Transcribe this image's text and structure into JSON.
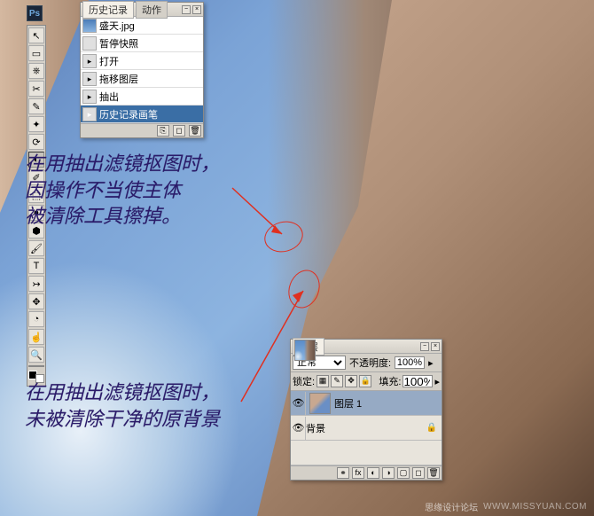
{
  "logo": "Ps",
  "tools": [
    "↖",
    "▭",
    "⎈",
    "✂",
    "✎",
    "✦",
    "⟳",
    "◐",
    "✐",
    "⬚",
    "●",
    "⬢",
    "🖌",
    "T",
    "↣",
    "✥",
    "◔",
    "☝",
    "🔍"
  ],
  "history_panel": {
    "tab_history": "历史记录",
    "tab_actions": "动作",
    "source_img": "盛天.jpg",
    "snapshot": "暂停快照",
    "items": [
      {
        "label": "打开"
      },
      {
        "label": "拖移图层"
      },
      {
        "label": "抽出"
      },
      {
        "label": "历史记录画笔"
      }
    ]
  },
  "layers_panel": {
    "tab_layers": "图层",
    "blend_mode": "正常",
    "opacity_label": "不透明度:",
    "opacity_val": "100%",
    "lock_label": "锁定:",
    "fill_label": "填充:",
    "fill_val": "100%",
    "layer1": "图层 1",
    "bg_layer": "背景"
  },
  "annotation1_l1": "在用抽出滤镜抠图时，",
  "annotation1_l2": "因操作不当使主体",
  "annotation1_l3": "被清除工具擦掉。",
  "annotation2_l1": "在用抽出滤镜抠图时，",
  "annotation2_l2": "未被清除干净的原背景",
  "watermark1": "思缘设计论坛",
  "watermark2": "WWW.MISSYUAN.COM"
}
